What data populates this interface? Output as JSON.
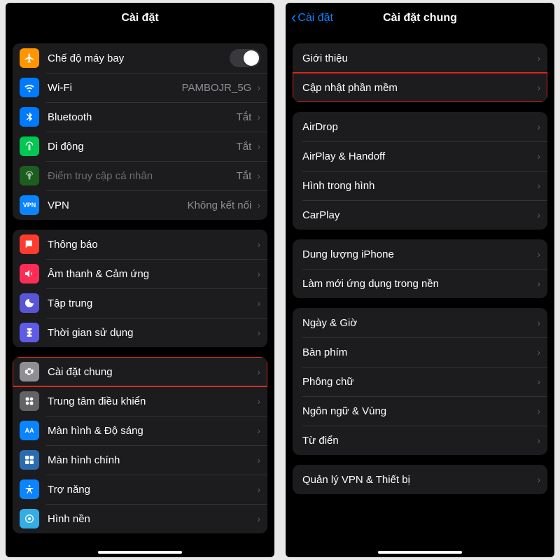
{
  "left": {
    "title": "Cài đặt",
    "group1": [
      {
        "name": "airplane",
        "label": "Chế độ máy bay",
        "iconBg": "bg-orange",
        "control": "switch"
      },
      {
        "name": "wifi",
        "label": "Wi-Fi",
        "value": "PAMBOJR_5G",
        "iconBg": "bg-blue",
        "chev": true
      },
      {
        "name": "bluetooth",
        "label": "Bluetooth",
        "value": "Tắt",
        "iconBg": "bg-blue",
        "chev": true
      },
      {
        "name": "cellular",
        "label": "Di động",
        "value": "Tắt",
        "iconBg": "bg-greenA",
        "chev": true
      },
      {
        "name": "hotspot",
        "label": "Điểm truy cập cá nhân",
        "value": "Tắt",
        "iconBg": "bg-link",
        "chev": true,
        "dim": true
      },
      {
        "name": "vpn",
        "label": "VPN",
        "value": "Không kết nối",
        "iconBg": "bg-vpn",
        "chev": true,
        "iconText": "VPN"
      }
    ],
    "group2": [
      {
        "name": "notifications",
        "label": "Thông báo",
        "iconBg": "bg-red",
        "chev": true
      },
      {
        "name": "sounds",
        "label": "Âm thanh & Cảm ứng",
        "iconBg": "bg-pink",
        "chev": true
      },
      {
        "name": "focus",
        "label": "Tập trung",
        "iconBg": "bg-indigo",
        "chev": true
      },
      {
        "name": "screentime",
        "label": "Thời gian sử dụng",
        "iconBg": "bg-purple",
        "chev": true
      }
    ],
    "group3": [
      {
        "name": "general",
        "label": "Cài đặt chung",
        "iconBg": "bg-gray",
        "chev": true,
        "highlighted": true
      },
      {
        "name": "controlcenter",
        "label": "Trung tâm điều khiển",
        "iconBg": "bg-grayD",
        "chev": true
      },
      {
        "name": "display",
        "label": "Màn hình & Độ sáng",
        "iconBg": "bg-blueA",
        "chev": true,
        "iconText": "AA"
      },
      {
        "name": "homescreen",
        "label": "Màn hình chính",
        "iconBg": "bg-blueB",
        "chev": true
      },
      {
        "name": "accessibility",
        "label": "Trợ năng",
        "iconBg": "bg-blueA",
        "chev": true
      },
      {
        "name": "wallpaper",
        "label": "Hình nền",
        "iconBg": "bg-cyan",
        "chev": true
      }
    ]
  },
  "right": {
    "back": "Cài đặt",
    "title": "Cài đặt chung",
    "groupA": [
      {
        "name": "about",
        "label": "Giới thiệu"
      },
      {
        "name": "software-update",
        "label": "Cập nhật phần mềm",
        "highlighted": true
      }
    ],
    "groupB": [
      {
        "name": "airdrop",
        "label": "AirDrop"
      },
      {
        "name": "airplay",
        "label": "AirPlay & Handoff"
      },
      {
        "name": "pip",
        "label": "Hình trong hình"
      },
      {
        "name": "carplay",
        "label": "CarPlay"
      }
    ],
    "groupC": [
      {
        "name": "storage",
        "label": "Dung lượng iPhone"
      },
      {
        "name": "bg-refresh",
        "label": "Làm mới ứng dụng trong nền"
      }
    ],
    "groupD": [
      {
        "name": "datetime",
        "label": "Ngày & Giờ"
      },
      {
        "name": "keyboard",
        "label": "Bàn phím"
      },
      {
        "name": "fonts",
        "label": "Phông chữ"
      },
      {
        "name": "language",
        "label": "Ngôn ngữ & Vùng"
      },
      {
        "name": "dictionary",
        "label": "Từ điển"
      }
    ],
    "groupE": [
      {
        "name": "vpn-device",
        "label": "Quản lý VPN & Thiết bị"
      }
    ]
  }
}
